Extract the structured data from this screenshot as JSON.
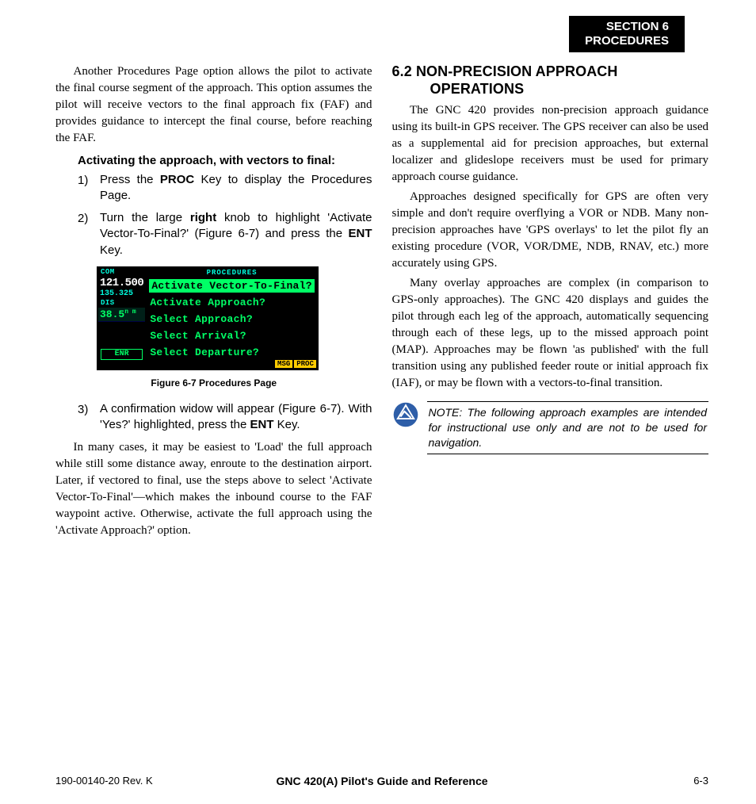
{
  "section_header": {
    "line1": "SECTION 6",
    "line2": "PROCEDURES"
  },
  "left_column": {
    "para1": "Another Procedures Page option allows the pilot to activate the final course segment of the approach.  This option assumes the pilot will receive vectors to the final approach fix (FAF) and provides guidance to intercept the final course, before reaching the FAF.",
    "sub_heading": "Activating the approach, with vectors to final:",
    "step1_num": "1)",
    "step1_a": "Press the ",
    "step1_b": "PROC",
    "step1_c": " Key to display the Procedures Page.",
    "step2_num": "2)",
    "step2_a": "Turn the large ",
    "step2_b": "right",
    "step2_c": " knob to highlight 'Activate Vector-To-Final?' (Figure 6-7) and press the ",
    "step2_d": "ENT",
    "step2_e": " Key.",
    "figure": {
      "com_label": "COM",
      "com_active": "121.500",
      "com_standby": "135.325",
      "dis_label": "DIS",
      "dis_value": "38.5",
      "dis_unit": "n m",
      "enr_label": "ENR",
      "proc_title": "PROCEDURES",
      "items": [
        "Activate Vector-To-Final?",
        "Activate Approach?",
        "Select Approach?",
        "Select Arrival?",
        "Select Departure?"
      ],
      "msg_label": "MSG",
      "proc_label": "PROC"
    },
    "figure_caption": "Figure 6-7  Procedures Page",
    "step3_num": "3)",
    "step3_a": "A confirmation widow will appear (Figure 6-7).  With 'Yes?' highlighted, press the ",
    "step3_b": "ENT",
    "step3_c": " Key.",
    "para2": "In many cases, it may be easiest to 'Load' the full approach while still some distance away, enroute to the destination airport.  Later, if vectored to final, use the steps above to select 'Activate Vector-To-Final'—which makes the inbound course to the FAF waypoint active.  Otherwise, activate the full approach using the 'Activate Approach?' option."
  },
  "right_column": {
    "heading_num": "6.2",
    "heading_line1": "NON-PRECISION APPROACH",
    "heading_line2": "OPERATIONS",
    "para1": "The GNC 420 provides non-precision approach guidance using its built-in GPS receiver.  The GPS receiver can also be used as a supplemental aid for precision approaches, but external localizer and glideslope receivers must be used for primary approach course guidance.",
    "para2": "Approaches designed specifically for GPS are often very simple and don't require overflying a VOR or NDB.  Many non-precision approaches have 'GPS overlays' to let the pilot fly an existing procedure (VOR, VOR/DME, NDB, RNAV, etc.) more accurately using GPS.",
    "para3": "Many overlay approaches are complex (in comparison to GPS-only approaches).  The GNC 420 displays and guides the pilot through each leg of the approach, automatically sequencing through each of these legs, up to the missed approach point (MAP).  Approaches may be flown 'as published' with the full transition using any published feeder route or initial approach fix (IAF), or may be flown with a vectors-to-final transition.",
    "note": "NOTE: The following approach examples are intended for instructional use only and are not to be used for navigation."
  },
  "footer": {
    "left": "190-00140-20  Rev. K",
    "center": "GNC 420(A) Pilot's Guide and Reference",
    "right": "6-3"
  }
}
